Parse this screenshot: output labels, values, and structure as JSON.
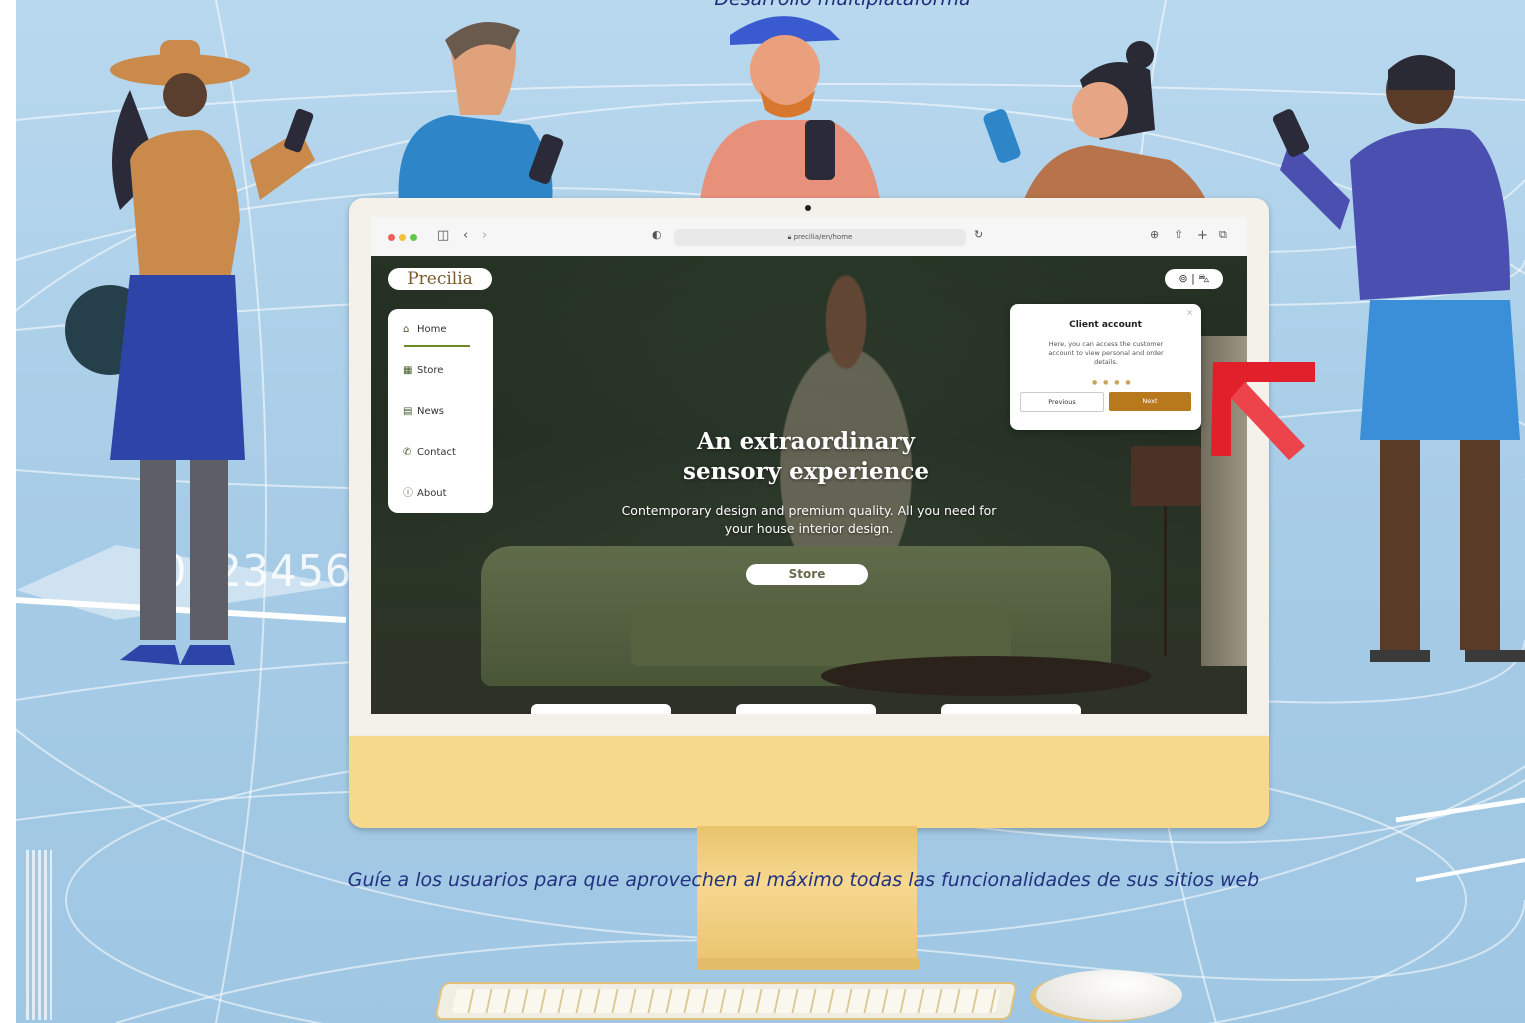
{
  "captions": {
    "top": "Desarrollo multiplataforma",
    "bottom": "Guíe a los usuarios para que aprovechen al máximo todas las funcionalidades de sus sitios web"
  },
  "decor": {
    "digits": "0123456"
  },
  "browser": {
    "url": "precilia/en/home",
    "icons": [
      "sidebar-icon",
      "back-icon",
      "forward-icon",
      "shield-icon",
      "lock-icon",
      "reload-icon",
      "download-icon",
      "share-icon",
      "new-tab-icon",
      "tabs-icon"
    ]
  },
  "site": {
    "logo": "Precilia",
    "nav": [
      {
        "label": "Home",
        "icon": "⌂"
      },
      {
        "label": "Store",
        "icon": "▦"
      },
      {
        "label": "News",
        "icon": "▤"
      },
      {
        "label": "Contact",
        "icon": "✆"
      },
      {
        "label": "About",
        "icon": "ⓘ"
      }
    ],
    "account_icons": "⊚ | ⛍",
    "hero": {
      "title_line1": "An extraordinary",
      "title_line2": "sensory experience",
      "subtitle": "Contemporary design and premium quality. All you need for your house interior design.",
      "button": "Store"
    },
    "popup": {
      "title": "Client account",
      "body": "Here, you can access the customer account to view personal and order details.",
      "dots": "● ● ● ●",
      "previous": "Previous",
      "next": "Next",
      "close": "×"
    }
  },
  "colors": {
    "background": "#a9cde6",
    "caption": "#1d2b78",
    "monitor_chin": "#f7d98b",
    "accent_button": "#b8791c",
    "arrow": "#e2202b"
  }
}
